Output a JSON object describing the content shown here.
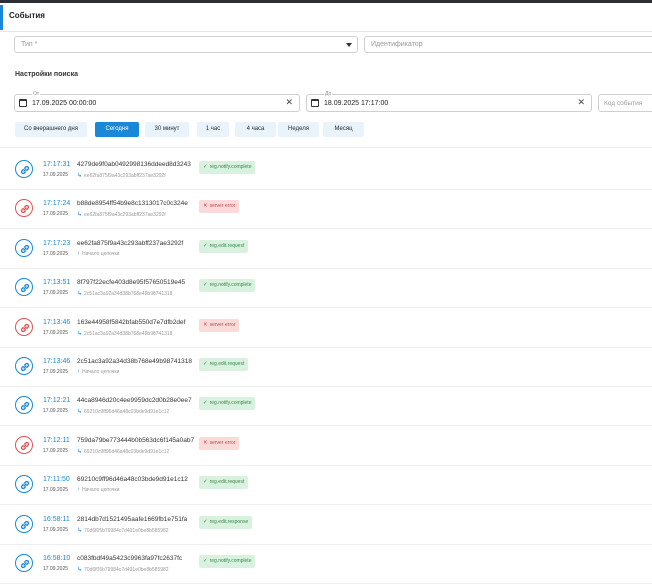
{
  "header": {
    "title": "События"
  },
  "filters": {
    "type_placeholder": "Тип *",
    "identifier_placeholder": "Идентификатор"
  },
  "search": {
    "title": "Настройки поиска",
    "from_label": "От",
    "from_value": "17.09.2025 00:00:00",
    "to_label": "До",
    "to_value": "18.09.2025 17:17:00",
    "event_code_placeholder": "Код события"
  },
  "ranges": [
    {
      "label": "Со вчерашнего дня",
      "active": false
    },
    {
      "label": "Сегодня",
      "active": true
    },
    {
      "label": "30 минут",
      "active": false
    },
    {
      "label": "1 час",
      "active": false
    },
    {
      "label": "4 часа",
      "active": false
    },
    {
      "label": "Неделя",
      "active": false
    },
    {
      "label": "Месяц",
      "active": false
    }
  ],
  "events": [
    {
      "time": "17:17:31",
      "date": "17.09.2025",
      "id": "4279de9f0ab0492998136ddeed8d3243",
      "parent": "ee62fa875f9a43c293abff237ae3292f",
      "parent_kind": "child",
      "status": "reg.notify.complete",
      "error": false
    },
    {
      "time": "17:17:24",
      "date": "17.09.2025",
      "id": "b88de8954ff54b9e8c1313017c0c324e",
      "parent": "ee62fa875f9a43c293abff237ae3292f",
      "parent_kind": "child",
      "status": "server error",
      "error": true
    },
    {
      "time": "17:17:23",
      "date": "17.09.2025",
      "id": "ee62fa875f9a43c293abff237ae3292f",
      "parent": "Начало цепочки",
      "parent_kind": "start",
      "status": "reg.edit.request",
      "error": false
    },
    {
      "time": "17:13:51",
      "date": "17.09.2025",
      "id": "8f797f22ecfe403d8e95f57650519e45",
      "parent": "2c51ac3a92a34d38b768e49b98741318",
      "parent_kind": "child",
      "status": "reg.notify.complete",
      "error": false
    },
    {
      "time": "17:13:46",
      "date": "17.09.2025",
      "id": "163e44958f5842bfab550d7e7dfb2def",
      "parent": "2c51ac3a92a34d38b768e49b98741318",
      "parent_kind": "child",
      "status": "server error",
      "error": true
    },
    {
      "time": "17:13:46",
      "date": "17.09.2025",
      "id": "2c51ac3a92a34d38b768e49b98741318",
      "parent": "Начало цепочки",
      "parent_kind": "start",
      "status": "reg.edit.request",
      "error": false
    },
    {
      "time": "17:12:21",
      "date": "17.09.2025",
      "id": "44ca8946d20c4ee9959dc2d0b28e0ee7",
      "parent": "69210c9ff96d46a48c03bde9d91e1c12",
      "parent_kind": "child",
      "status": "reg.notify.complete",
      "error": false
    },
    {
      "time": "17:12:11",
      "date": "17.09.2025",
      "id": "759da79be773444b0b563dc6f145a0ab7",
      "parent": "69210c9ff96d46a48c03bde9d91e1c12",
      "parent_kind": "child",
      "status": "server error",
      "error": true
    },
    {
      "time": "17:11:50",
      "date": "17.09.2025",
      "id": "69210c9ff96d46a48c03bde9d91e1c12",
      "parent": "Начало цепочки",
      "parent_kind": "start",
      "status": "reg.edit.request",
      "error": false
    },
    {
      "time": "16:58:11",
      "date": "17.09.2025",
      "id": "2814db7d1521495aafe1669fb1e751fa",
      "parent": "70d6f05b79984c7d491e0be8b585982",
      "parent_kind": "child",
      "status": "reg.edit.response",
      "error": false
    },
    {
      "time": "16:58:10",
      "date": "17.09.2025",
      "id": "c083fbdf49a5423c9963fa97fc2637fc",
      "parent": "70d6f05b79984c7d491e0be8b585982",
      "parent_kind": "child",
      "status": "reg.notify.complete",
      "error": false
    }
  ],
  "colors": {
    "accent": "#1a88d9",
    "error": "#e05353",
    "ok_bg": "#d9f2df",
    "err_bg": "#fbdada"
  },
  "icons": {
    "event": "link-icon",
    "start": "arrow-up-icon",
    "child": "corner-arrow-icon",
    "ok": "check-icon",
    "error": "cross-icon"
  }
}
